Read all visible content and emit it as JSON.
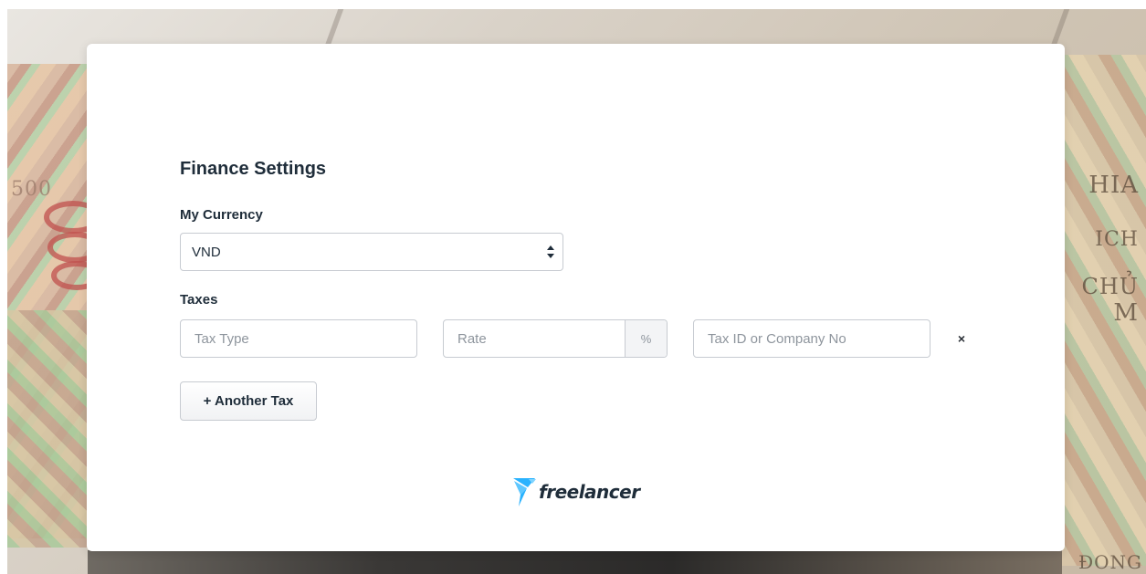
{
  "page": {
    "title": "Finance Settings"
  },
  "currency": {
    "label": "My Currency",
    "selected": "VND"
  },
  "taxes": {
    "label": "Taxes",
    "tax_type_placeholder": "Tax Type",
    "rate_placeholder": "Rate",
    "rate_unit": "%",
    "tax_id_placeholder": "Tax ID or Company No",
    "remove_symbol": "×",
    "add_button": "+ Another Tax"
  },
  "brand": {
    "name": "freelancer",
    "accent_color": "#29b2fe",
    "text_color": "#1f2d3a"
  },
  "background": {
    "note_text_right": [
      "HIA",
      "ICH",
      "CHỦ",
      "M",
      "ĐONG"
    ],
    "note_text_left": "500"
  }
}
